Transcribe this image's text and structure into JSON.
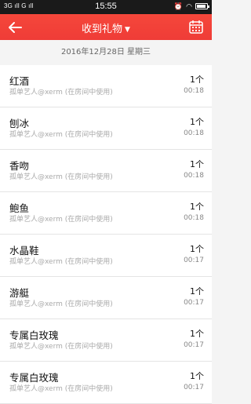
{
  "statusbar": {
    "left": "3G ıll G ıll",
    "time": "15:55"
  },
  "header": {
    "title": "收到礼物"
  },
  "date": "2016年12月28日 星期三",
  "rows": [
    {
      "name": "红酒",
      "sender": "孤单艺人@xerm (在房间中使用)",
      "qty": "1个",
      "time": "00:18"
    },
    {
      "name": "刨冰",
      "sender": "孤单艺人@xerm (在房间中使用)",
      "qty": "1个",
      "time": "00:18"
    },
    {
      "name": "香吻",
      "sender": "孤单艺人@xerm (在房间中使用)",
      "qty": "1个",
      "time": "00:18"
    },
    {
      "name": "鲍鱼",
      "sender": "孤单艺人@xerm (在房间中使用)",
      "qty": "1个",
      "time": "00:18"
    },
    {
      "name": "水晶鞋",
      "sender": "孤单艺人@xerm (在房间中使用)",
      "qty": "1个",
      "time": "00:17"
    },
    {
      "name": "游艇",
      "sender": "孤单艺人@xerm (在房间中使用)",
      "qty": "1个",
      "time": "00:17"
    },
    {
      "name": "专属白玫瑰",
      "sender": "孤单艺人@xerm (在房间中使用)",
      "qty": "1个",
      "time": "00:17"
    },
    {
      "name": "专属白玫瑰",
      "sender": "孤单艺人@xerm (在房间中使用)",
      "qty": "1个",
      "time": "00:17"
    }
  ]
}
